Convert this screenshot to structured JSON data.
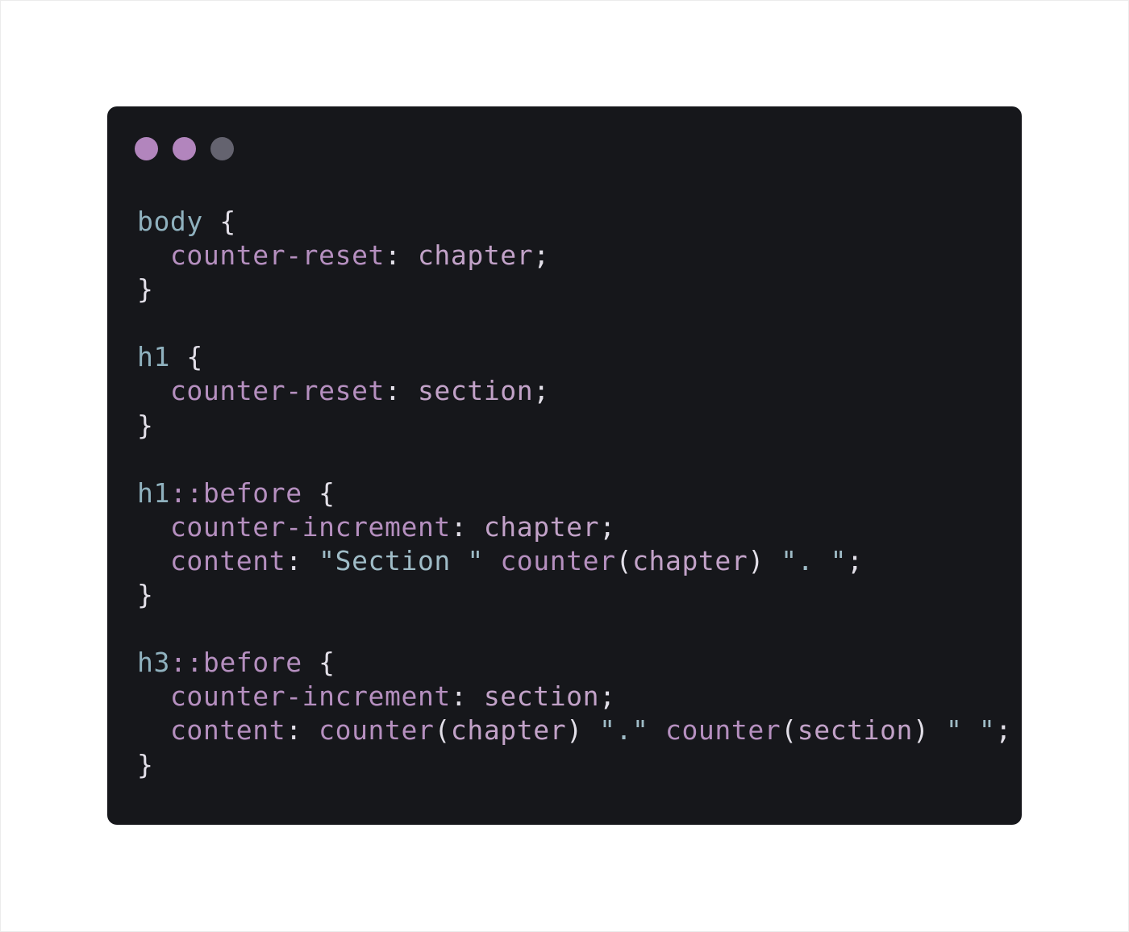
{
  "window": {
    "dots": [
      {
        "name": "dot-1",
        "color": "#b285bd"
      },
      {
        "name": "dot-2",
        "color": "#b285bd"
      },
      {
        "name": "dot-3",
        "color": "#64636f"
      }
    ]
  },
  "colors": {
    "background": "#16171b",
    "selector": "#8fb1be",
    "property": "#b58fbf",
    "value": "#c2a2c8",
    "string": "#9fbcc7",
    "punctuation": "#e2dfe8"
  },
  "code": {
    "r1": {
      "selector": "body",
      "open": " {",
      "p1": "counter-reset",
      "colon1": ": ",
      "v1": "chapter",
      "semi1": ";",
      "close": "}"
    },
    "r2": {
      "selector": "h1",
      "open": " {",
      "p1": "counter-reset",
      "colon1": ": ",
      "v1": "section",
      "semi1": ";",
      "close": "}"
    },
    "r3": {
      "sel_a": "h1",
      "sel_b": "::before",
      "open": " {",
      "p1": "counter-increment",
      "colon1": ": ",
      "v1": "chapter",
      "semi1": ";",
      "p2": "content",
      "colon2": ": ",
      "s1": "\"Section \"",
      "fn1": "counter",
      "lp1": "(",
      "arg1": "chapter",
      "rp1": ")",
      "s2": "\". \"",
      "semi2": ";",
      "close": "}"
    },
    "r4": {
      "sel_a": "h3",
      "sel_b": "::before",
      "open": " {",
      "p1": "counter-increment",
      "colon1": ": ",
      "v1": "section",
      "semi1": ";",
      "p2": "content",
      "colon2": ": ",
      "fn1": "counter",
      "lp1": "(",
      "arg1": "chapter",
      "rp1": ")",
      "s1": "\".\"",
      "fn2": "counter",
      "lp2": "(",
      "arg2": "section",
      "rp2": ")",
      "s2": "\" \"",
      "semi2": ";",
      "close": "}"
    }
  }
}
